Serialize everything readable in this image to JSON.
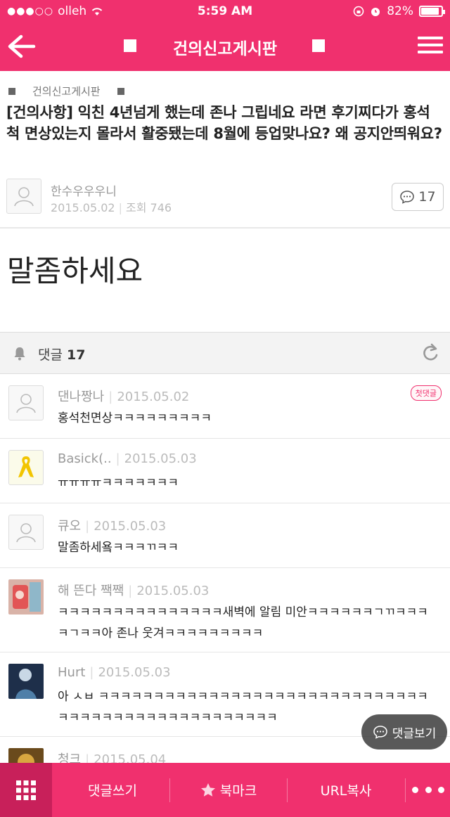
{
  "status": {
    "carrier": "olleh",
    "time": "5:59 AM",
    "battery": "82%",
    "battery_level": 0.82
  },
  "header": {
    "title": "건의신고게시판"
  },
  "post": {
    "category": "건의신고게시판",
    "title": "[건의사항] 익친 4년넘게 했는데 존나 그립네요 라면 후기찌다가 홍석척 면상있는지 몰라서 활중됐는데 8월에 등업맞나요? 왜 공지안띄워요?",
    "author": "한수우우우니",
    "date": "2015.05.02",
    "views": "조회 746",
    "comment_count": "17",
    "body": "말좀하세요"
  },
  "comments_header": {
    "label": "댓글",
    "count": "17"
  },
  "comments": [
    {
      "name": "댄나짱나",
      "date": "2015.05.02",
      "text": "홍석천면상ㅋㅋㅋㅋㅋㅋㅋㅋㅋ",
      "badge": "첫댓글",
      "avatar": "default"
    },
    {
      "name": "Basick(..",
      "date": "2015.05.03",
      "text": "ㅠㅠㅠㅠㅋㅋㅋㅋㅋㅋㅋ",
      "avatar": "ribbon"
    },
    {
      "name": "큐오",
      "date": "2015.05.03",
      "text": "말좀하세욬ㅋㅋㅋㄲㅋㅋ",
      "avatar": "default"
    },
    {
      "name": "해 뜬다 짹짹",
      "date": "2015.05.03",
      "text": "ㅋㅋㅋㅋㅋㅋㅋㅋㅋㅋㅋㅋㅋㅋㅋ새벽에 알림 미안ㅋㅋㅋㅋㅋㅋㄱㄲㅋㅋㅋㅋㄱㅋㅋ아 존나 웃겨ㅋㅋㅋㅋㅋㅋㅋㅋㅋ",
      "avatar": "photo"
    },
    {
      "name": "Hurt",
      "date": "2015.05.03",
      "text": "아 ㅅㅂ ㅋㅋㅋㅋㅋㅋㅋㅋㅋㅋㅋㅋㅋㅋㅋㅋㅋㅋㅋㅋㅋㅋㅋㅋㅋㅋㅋㅋㅋㅋㅋㅋㅋㅋㅋㅋㅋㅋㅋㅋㅋㅋㅋㅋㅋㅋㅋㅋㅋㅋ",
      "avatar": "photo-dark"
    },
    {
      "name": "청크",
      "date": "2015.05.04",
      "text": "",
      "avatar": "photo-gold"
    }
  ],
  "floating": {
    "view_comments": "댓글보기"
  },
  "bottom": {
    "write_comment": "댓글쓰기",
    "bookmark": "북마크",
    "copy_url": "URL복사"
  },
  "colors": {
    "accent": "#f0306e",
    "accent_dark": "#c8205a"
  }
}
